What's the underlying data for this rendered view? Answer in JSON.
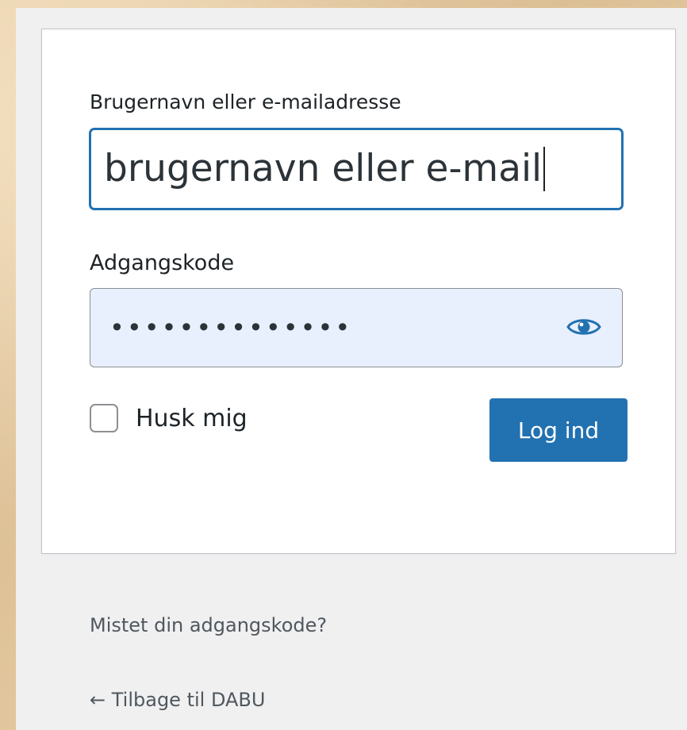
{
  "login_form": {
    "username_label": "Brugernavn eller e-mailadresse",
    "username_value": "brugernavn eller e-mail",
    "password_label": "Adgangskode",
    "password_value": "••••••••••••••",
    "remember_label": "Husk mig",
    "remember_checked": false,
    "submit_label": "Log ind"
  },
  "links": {
    "lost_password": "Mistet din adgangskode?",
    "back_to_site": "← Tilbage til DABU"
  },
  "icons": {
    "password_toggle": "eye-icon"
  },
  "colors": {
    "accent": "#2271b1",
    "panel_background": "#f0f0f1",
    "autofill_background": "#e8f0fe"
  }
}
